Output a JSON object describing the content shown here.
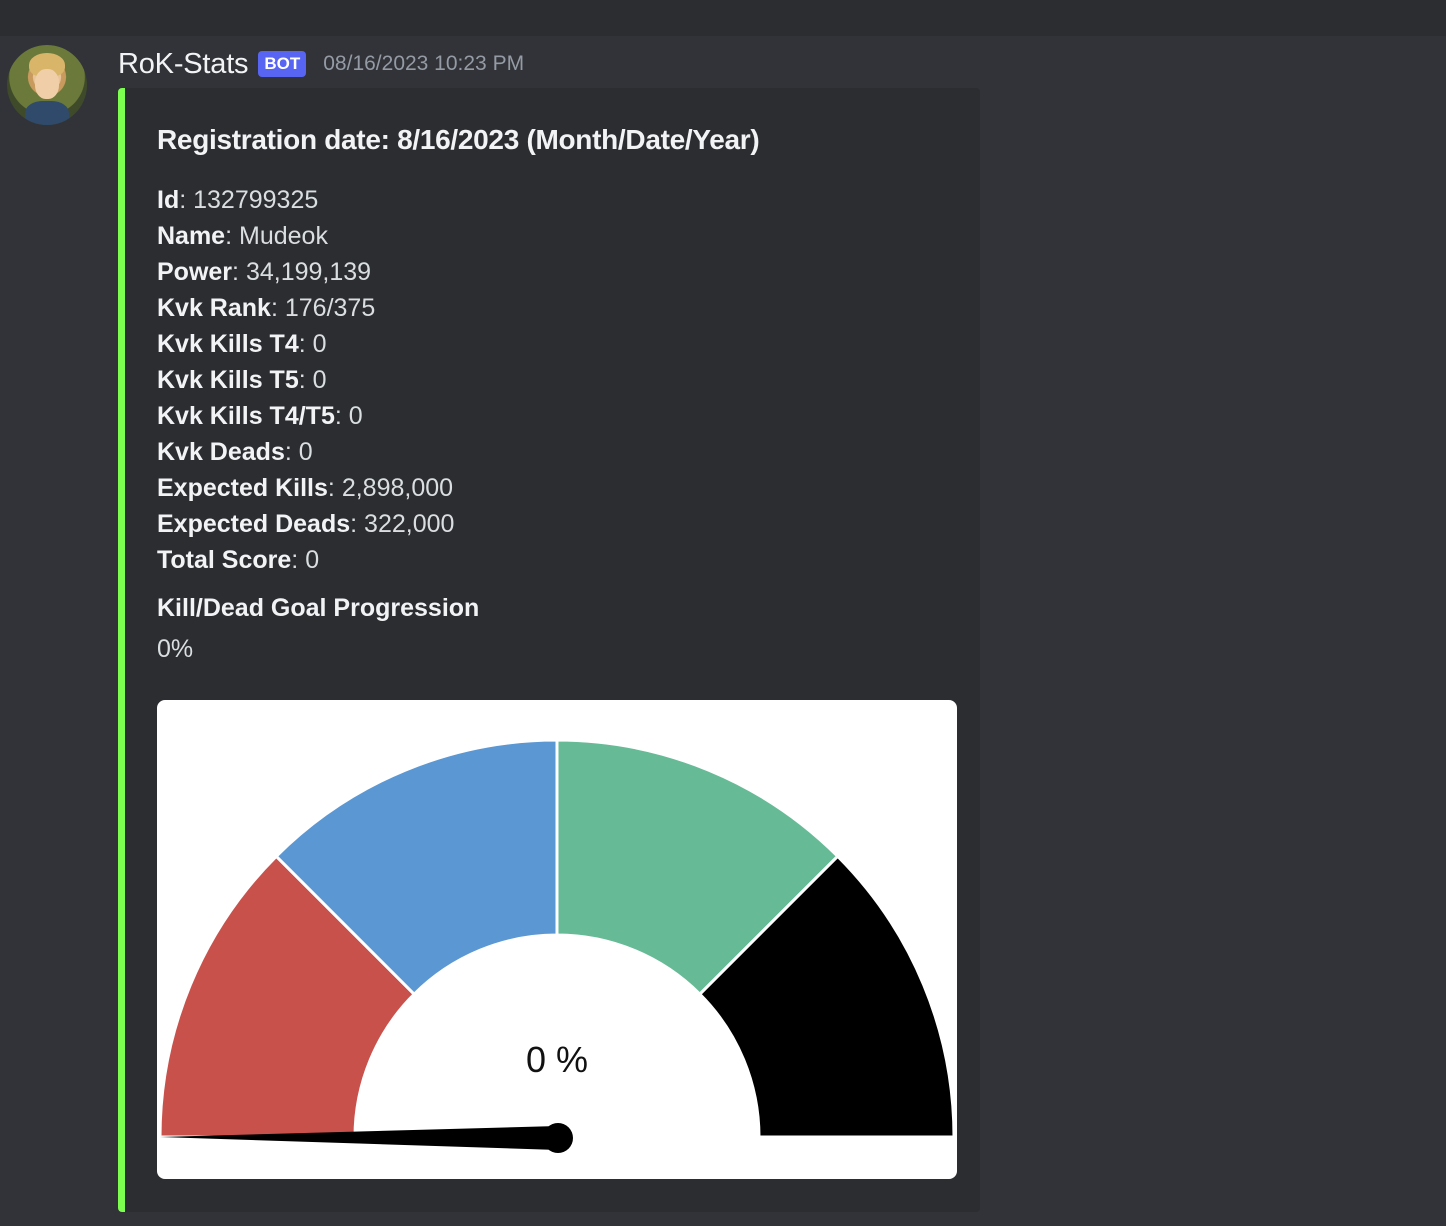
{
  "message": {
    "username": "RoK-Stats",
    "badge": "BOT",
    "timestamp": "08/16/2023 10:23 PM",
    "avatar_icon": "knight-avatar-icon"
  },
  "embed": {
    "accent_color": "#7dff4f",
    "title": "Registration date: 8/16/2023 (Month/Date/Year)",
    "fields": [
      {
        "label": "Id",
        "value": "132799325"
      },
      {
        "label": "Name",
        "value": "Mudeok"
      },
      {
        "label": "Power",
        "value": "34,199,139"
      },
      {
        "label": "Kvk Rank",
        "value": "176/375"
      },
      {
        "label": "Kvk Kills T4",
        "value": "0"
      },
      {
        "label": "Kvk Kills T5",
        "value": "0"
      },
      {
        "label": "Kvk Kills T4/T5",
        "value": "0"
      },
      {
        "label": "Kvk Deads",
        "value": "0"
      },
      {
        "label": "Expected Kills",
        "value": "2,898,000"
      },
      {
        "label": "Expected Deads",
        "value": "322,000"
      },
      {
        "label": "Total Score",
        "value": "0"
      }
    ],
    "goal_section": {
      "name": "Kill/Dead Goal Progression",
      "value": "0%"
    }
  },
  "chart_data": {
    "type": "gauge",
    "value": 0,
    "center_label": "0 %",
    "segments": [
      {
        "color": "#c8514c",
        "fraction": 0.25
      },
      {
        "color": "#5b97d3",
        "fraction": 0.25
      },
      {
        "color": "#66ba96",
        "fraction": 0.25
      },
      {
        "color": "#000000",
        "fraction": 0.25
      }
    ]
  }
}
